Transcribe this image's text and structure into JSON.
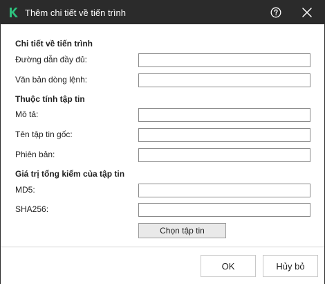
{
  "window": {
    "title": "Thêm chi tiết về tiến trình",
    "logo_icon": "kaspersky-k-logo",
    "help_icon": "question-circle-icon",
    "close_icon": "close-icon"
  },
  "colors": {
    "titlebar_bg": "#2b2b2b",
    "logo_green": "#2ec27e"
  },
  "process_details": {
    "heading": "Chi tiết về tiến trình",
    "full_path_label": "Đường dẫn đầy đủ:",
    "full_path_value": "",
    "command_line_label": "Văn bản dòng lệnh:",
    "command_line_value": ""
  },
  "file_attributes": {
    "heading": "Thuộc tính tập tin",
    "description_label": "Mô tả:",
    "description_value": "",
    "original_name_label": "Tên tập tin gốc:",
    "original_name_value": "",
    "version_label": "Phiên bản:",
    "version_value": ""
  },
  "checksum": {
    "heading": "Giá trị tổng kiểm của tập tin",
    "md5_label": "MD5:",
    "md5_value": "",
    "sha256_label": "SHA256:",
    "sha256_value": "",
    "browse_label": "Chọn tập tin"
  },
  "footer": {
    "ok_label": "OK",
    "cancel_label": "Hủy bỏ"
  }
}
